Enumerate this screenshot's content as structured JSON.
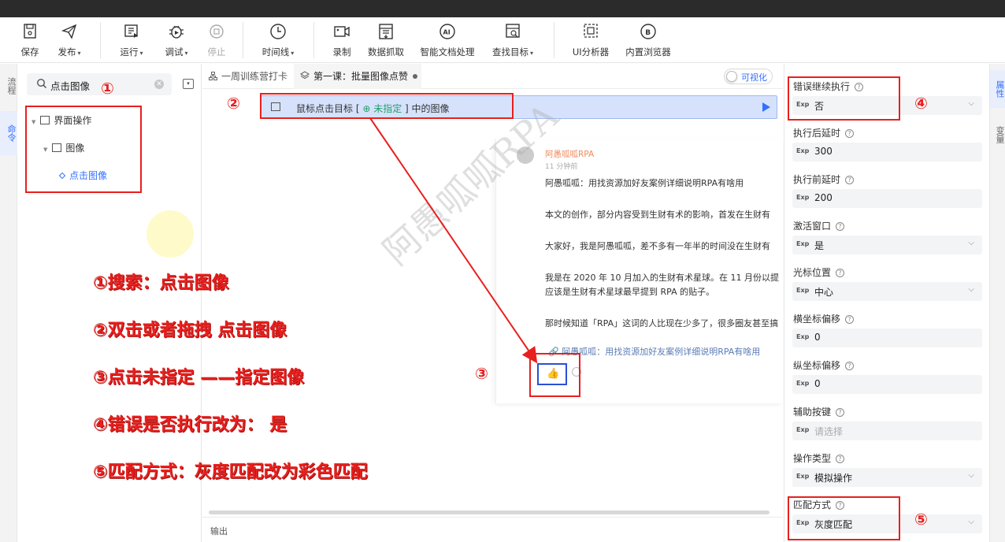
{
  "toolbar": {
    "buttons": [
      {
        "label": "保存",
        "caret": false
      },
      {
        "label": "发布",
        "caret": true
      },
      {
        "label": "运行",
        "caret": true
      },
      {
        "label": "调试",
        "caret": true
      },
      {
        "label": "停止",
        "caret": false
      },
      {
        "label": "时间线",
        "caret": true
      },
      {
        "label": "录制",
        "caret": false
      },
      {
        "label": "数据抓取",
        "caret": false
      },
      {
        "label": "智能文档处理",
        "caret": false
      },
      {
        "label": "查找目标",
        "caret": true
      },
      {
        "label": "UI分析器",
        "caret": false
      },
      {
        "label": "内置浏览器",
        "caret": false
      }
    ],
    "caret_glyph": "▾"
  },
  "left_strip": {
    "tab_flow": "流程",
    "tab_commands": "命令"
  },
  "command_panel": {
    "search_value": "点击图像",
    "tree": {
      "group": "界面操作",
      "subgroup": "图像",
      "leaf": "点击图像"
    }
  },
  "tabs": [
    {
      "label": "一周训练营打卡",
      "active": false
    },
    {
      "label": "第一课：批量图像点赞",
      "active": true
    }
  ],
  "toggle_label": "可视化",
  "canvas": {
    "command_row": {
      "prefix": "鼠标点击目标 [",
      "target": "未指定",
      "suffix": "] 中的图像"
    }
  },
  "preview": {
    "author": "阿愚呱呱RPA",
    "time": "11 分钟前",
    "lines": [
      "阿愚呱呱：用找资源加好友案例详细说明RPA有啥用",
      "本文的创作，部分内容受到生财有术的影响，首发在生财有",
      "大家好，我是阿愚呱呱，差不多有一年半的时间没在生财有",
      "我是在 2020 年 10 月加入的生财有术星球。在 11 月份以提",
      "应该是生财有术星球最早提到 RPA 的贴子。",
      "那时候知道「RPA」这词的人比现在少多了，很多圈友甚至搞"
    ],
    "link": "🔗 阿愚呱呱：用找资源加好友案例详细说明RPA有啥用",
    "like_glyph": "👍",
    "watermark": "阿愚呱呱RPA"
  },
  "output_label": "输出",
  "properties": [
    {
      "label": "错误继续执行",
      "value": "否",
      "dropdown": true,
      "placeholder": false
    },
    {
      "label": "执行后延时",
      "value": "300",
      "dropdown": false,
      "placeholder": false
    },
    {
      "label": "执行前延时",
      "value": "200",
      "dropdown": false,
      "placeholder": false
    },
    {
      "label": "激活窗口",
      "value": "是",
      "dropdown": true,
      "placeholder": false
    },
    {
      "label": "光标位置",
      "value": "中心",
      "dropdown": true,
      "placeholder": false
    },
    {
      "label": "横坐标偏移",
      "value": "0",
      "dropdown": false,
      "placeholder": false
    },
    {
      "label": "纵坐标偏移",
      "value": "0",
      "dropdown": false,
      "placeholder": false
    },
    {
      "label": "辅助按键",
      "value": "请选择",
      "dropdown": false,
      "placeholder": true
    },
    {
      "label": "操作类型",
      "value": "模拟操作",
      "dropdown": true,
      "placeholder": false
    },
    {
      "label": "匹配方式",
      "value": "灰度匹配",
      "dropdown": true,
      "placeholder": false
    }
  ],
  "exp_tag": "Exp",
  "help_glyph": "?",
  "right_strip": {
    "tab_props": "属性",
    "tab_vars": "变量"
  },
  "annotations": {
    "numbers": [
      "①",
      "②",
      "③",
      "④",
      "⑤"
    ],
    "instructions": [
      "①搜索：点击图像",
      "②双击或者拖拽 点击图像",
      "③点击未指定 ——指定图像",
      "④错误是否执行改为： 是",
      "⑤匹配方式：灰度匹配改为彩色匹配"
    ],
    "color": "#e8201e"
  },
  "colors": {
    "accent": "#3370ff",
    "target_green": "#22a06b",
    "author_orange": "#f08a5d"
  }
}
